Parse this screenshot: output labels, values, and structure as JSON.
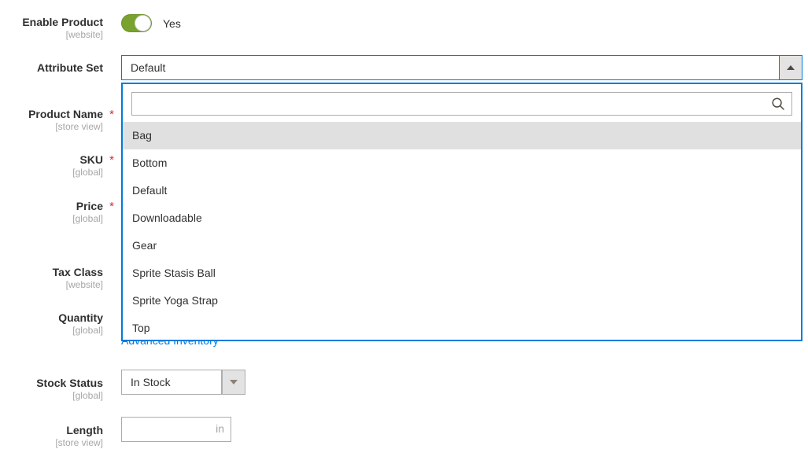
{
  "colors": {
    "accent_blue": "#007bdb",
    "toggle_green": "#79a22e",
    "required_red": "#e22626",
    "label_text": "#303030",
    "scope_text": "#a6a6a6",
    "highlight_gray": "#e0e0e0",
    "button_gray": "#e3e3e3"
  },
  "fields": {
    "enable_product": {
      "label": "Enable Product",
      "scope": "[website]",
      "required": false,
      "toggle_state_label": "Yes"
    },
    "attribute_set": {
      "label": "Attribute Set",
      "scope": "",
      "required": false,
      "value": "Default",
      "toggle_icon": "chevron-up-icon"
    },
    "product_name": {
      "label": "Product Name",
      "scope": "[store view]",
      "required": true
    },
    "sku": {
      "label": "SKU",
      "scope": "[global]",
      "required": true
    },
    "price": {
      "label": "Price",
      "scope": "[global]",
      "required": true
    },
    "tax_class": {
      "label": "Tax Class",
      "scope": "[website]",
      "required": false
    },
    "quantity": {
      "label": "Quantity",
      "scope": "[global]",
      "required": false
    },
    "stock_status": {
      "label": "Stock Status",
      "scope": "[global]",
      "required": false,
      "value": "In Stock",
      "arrow_icon": "chevron-down-icon"
    },
    "length": {
      "label": "Length",
      "scope": "[store view]",
      "required": false,
      "value": "",
      "unit": "in"
    }
  },
  "advanced_inventory_link": "Advanced Inventory",
  "attribute_set_dropdown": {
    "search": {
      "value": "",
      "placeholder": "",
      "icon": "search-icon"
    },
    "options": [
      {
        "label": "Bag",
        "selected": true
      },
      {
        "label": "Bottom",
        "selected": false
      },
      {
        "label": "Default",
        "selected": false
      },
      {
        "label": "Downloadable",
        "selected": false
      },
      {
        "label": "Gear",
        "selected": false
      },
      {
        "label": "Sprite Stasis Ball",
        "selected": false
      },
      {
        "label": "Sprite Yoga Strap",
        "selected": false
      },
      {
        "label": "Top",
        "selected": false
      }
    ]
  }
}
